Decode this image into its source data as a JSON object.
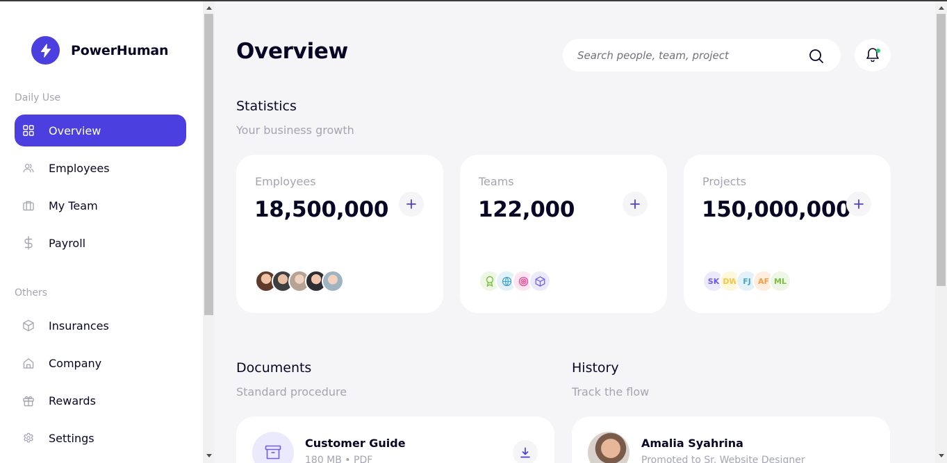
{
  "brand": {
    "name": "PowerHuman"
  },
  "sidebar": {
    "daily_label": "Daily Use",
    "daily_items": [
      {
        "label": "Overview",
        "icon": "grid-icon",
        "active": true
      },
      {
        "label": "Employees",
        "icon": "users-icon"
      },
      {
        "label": "My Team",
        "icon": "briefcase-icon"
      },
      {
        "label": "Payroll",
        "icon": "dollar-icon"
      }
    ],
    "others_label": "Others",
    "other_items": [
      {
        "label": "Insurances",
        "icon": "box-icon"
      },
      {
        "label": "Company",
        "icon": "home-icon"
      },
      {
        "label": "Rewards",
        "icon": "gift-icon"
      },
      {
        "label": "Settings",
        "icon": "gear-icon"
      }
    ]
  },
  "header": {
    "title": "Overview",
    "search_placeholder": "Search people, team, project"
  },
  "statistics": {
    "title": "Statistics",
    "subtitle": "Your business growth",
    "cards": [
      {
        "label": "Employees",
        "value": "18,500,000"
      },
      {
        "label": "Teams",
        "value": "122,000"
      },
      {
        "label": "Projects",
        "value": "150,000,000",
        "initials": [
          "SK",
          "DW",
          "FJ",
          "AF",
          "ML"
        ]
      }
    ]
  },
  "documents": {
    "title": "Documents",
    "subtitle": "Standard procedure",
    "items": [
      {
        "name": "Customer Guide",
        "meta": "180 MB • PDF"
      }
    ]
  },
  "history": {
    "title": "History",
    "subtitle": "Track the flow",
    "items": [
      {
        "name": "Amalia Syahrina",
        "detail": "Promoted to Sr. Website Designer"
      }
    ]
  },
  "colors": {
    "accent": "#4b3fe0",
    "text": "#070625",
    "muted": "#a4a4b2",
    "background": "#f5f5f7",
    "notification_dot": "#31c27c"
  }
}
